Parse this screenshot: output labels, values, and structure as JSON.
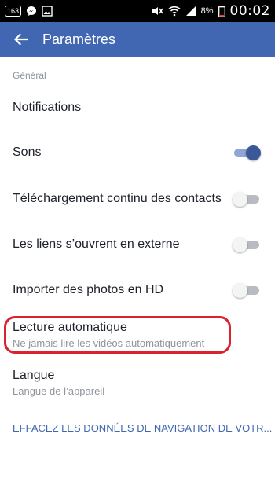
{
  "status_bar": {
    "notification_count": "163",
    "battery_percent": "8%",
    "time": "00:02",
    "icons": [
      "notification-badge-icon",
      "messenger-icon",
      "image-icon",
      "mute-icon",
      "wifi-icon",
      "signal-icon",
      "battery-icon"
    ]
  },
  "app_bar": {
    "title": "Paramètres",
    "back_icon": "arrow-left-icon",
    "color": "#4267b2"
  },
  "settings": {
    "section_title": "Général",
    "notifications_label": "Notifications",
    "sounds": {
      "label": "Sons",
      "enabled": true
    },
    "contacts_upload": {
      "label": "Téléchargement continu des contacts",
      "enabled": false
    },
    "external_links": {
      "label": "Les liens s’ouvrent en externe",
      "enabled": false
    },
    "hd_photos": {
      "label": "Importer des photos en HD",
      "enabled": false
    },
    "autoplay": {
      "label": "Lecture automatique",
      "value": "Ne jamais lire les vidéos automatiquement",
      "highlighted": true,
      "highlight_color": "#d9232f"
    },
    "language": {
      "label": "Langue",
      "value": "Langue de l’appareil"
    },
    "clear_data_link": "EFFACEZ LES DONNÉES DE NAVIGATION DE VOTR..."
  }
}
